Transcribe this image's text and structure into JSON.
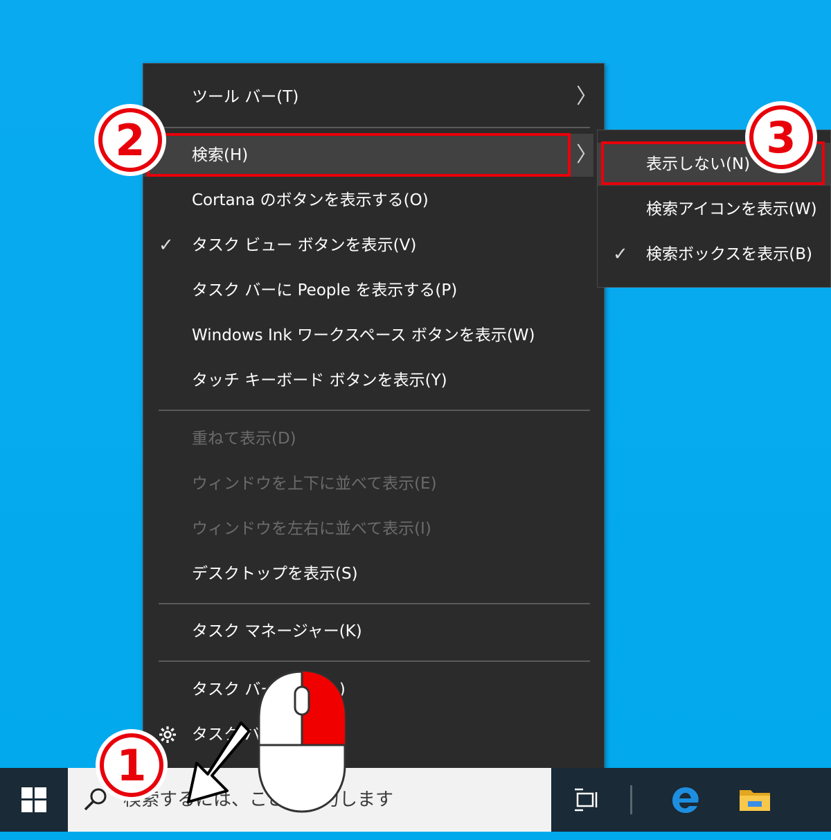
{
  "menu": {
    "items": [
      {
        "label": "ツール バー(T)",
        "has_submenu": true
      },
      {
        "label": "検索(H)",
        "has_submenu": true,
        "highlighted": true
      },
      {
        "label": "Cortana のボタンを表示する(O)"
      },
      {
        "label": "タスク ビュー ボタンを表示(V)",
        "checked": true,
        "check": "✓"
      },
      {
        "label": "タスク バーに People を表示する(P)"
      },
      {
        "label": "Windows Ink ワークスペース ボタンを表示(W)"
      },
      {
        "label": "タッチ キーボード ボタンを表示(Y)"
      },
      {
        "label": "重ねて表示(D)",
        "disabled": true
      },
      {
        "label": "ウィンドウを上下に並べて表示(E)",
        "disabled": true
      },
      {
        "label": "ウィンドウを左右に並べて表示(I)",
        "disabled": true
      },
      {
        "label": "デスクトップを表示(S)"
      },
      {
        "label": "タスク マネージャー(K)"
      },
      {
        "label": "タスク バーを",
        "partially_obscured": true
      },
      {
        "label": "タスク バ",
        "partially_obscured": true,
        "icon": "gear-icon"
      }
    ],
    "arrow": "〉",
    "partial_suffix": "L)"
  },
  "submenu": {
    "items": [
      {
        "label": "表示しない(N)",
        "highlighted": true
      },
      {
        "label": "検索アイコンを表示(W)"
      },
      {
        "label": "検索ボックスを表示(B)",
        "checked": true,
        "check": "✓"
      }
    ]
  },
  "annotations": {
    "step1": "1",
    "step2": "2",
    "step3": "3",
    "accent_color": "#e8000b"
  },
  "taskbar": {
    "search_placeholder": "検索するには、ここに入力します",
    "icons": [
      "windows-start-icon",
      "search-icon",
      "task-view-icon",
      "edge-icon",
      "file-explorer-icon"
    ]
  },
  "colors": {
    "desktop": "#00a8ec",
    "menu_bg": "#2b2b2b",
    "menu_highlight": "#414141",
    "taskbar_bg": "#1a2a36"
  }
}
